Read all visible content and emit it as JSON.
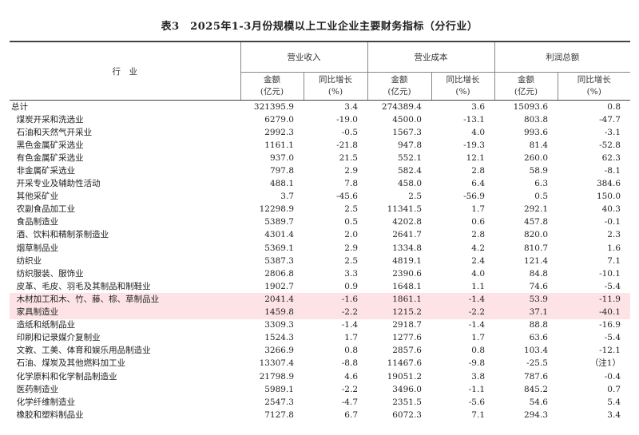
{
  "title": "表3　2025年1-3月份规模以上工业企业主要财务指标（分行业）",
  "header": {
    "industry": "行　业",
    "groups": [
      "营业收入",
      "营业成本",
      "利润总额"
    ],
    "amount": [
      "金额",
      "(亿元)"
    ],
    "growth": [
      "同比增长",
      "(%)"
    ]
  },
  "rows": [
    {
      "name": "总计",
      "v": [
        "321395.9",
        "3.4",
        "274389.4",
        "3.6",
        "15093.6",
        "0.8"
      ]
    },
    {
      "name": "  煤炭开采和洗选业",
      "v": [
        "6279.0",
        "-19.0",
        "4500.0",
        "-13.1",
        "803.8",
        "-47.7"
      ]
    },
    {
      "name": "  石油和天然气开采业",
      "v": [
        "2992.3",
        "-0.5",
        "1567.3",
        "4.0",
        "993.6",
        "-3.1"
      ]
    },
    {
      "name": "  黑色金属矿采选业",
      "v": [
        "1161.1",
        "-21.8",
        "947.8",
        "-19.3",
        "81.4",
        "-52.8"
      ]
    },
    {
      "name": "  有色金属矿采选业",
      "v": [
        "937.0",
        "21.5",
        "552.1",
        "12.1",
        "260.0",
        "62.3"
      ]
    },
    {
      "name": "  非金属矿采选业",
      "v": [
        "797.8",
        "2.9",
        "582.4",
        "2.8",
        "58.9",
        "-8.1"
      ]
    },
    {
      "name": "  开采专业及辅助性活动",
      "v": [
        "488.1",
        "7.8",
        "458.0",
        "6.4",
        "6.3",
        "384.6"
      ]
    },
    {
      "name": "  其他采矿业",
      "v": [
        "3.7",
        "-45.6",
        "2.5",
        "-56.9",
        "0.5",
        "150.0"
      ]
    },
    {
      "name": "  农副食品加工业",
      "v": [
        "12298.9",
        "2.5",
        "11341.5",
        "1.7",
        "292.1",
        "40.3"
      ]
    },
    {
      "name": "  食品制造业",
      "v": [
        "5389.7",
        "0.5",
        "4202.8",
        "0.6",
        "457.8",
        "-0.1"
      ]
    },
    {
      "name": "  酒、饮料和精制茶制造业",
      "v": [
        "4301.4",
        "2.0",
        "2641.7",
        "2.8",
        "820.0",
        "2.3"
      ]
    },
    {
      "name": "  烟草制品业",
      "v": [
        "5369.1",
        "2.9",
        "1334.8",
        "4.2",
        "810.7",
        "1.6"
      ]
    },
    {
      "name": "  纺织业",
      "v": [
        "5387.3",
        "2.5",
        "4819.1",
        "2.4",
        "121.4",
        "7.1"
      ]
    },
    {
      "name": "  纺织服装、服饰业",
      "v": [
        "2806.8",
        "3.3",
        "2390.6",
        "4.0",
        "84.8",
        "-10.1"
      ]
    },
    {
      "name": "  皮革、毛皮、羽毛及其制品和制鞋业",
      "v": [
        "1902.7",
        "0.9",
        "1648.1",
        "1.1",
        "74.6",
        "-5.4"
      ]
    },
    {
      "name": "  木材加工和木、竹、藤、棕、草制品业",
      "v": [
        "2041.4",
        "-1.6",
        "1861.1",
        "-1.4",
        "53.9",
        "-11.9"
      ],
      "highlight": true
    },
    {
      "name": "  家具制造业",
      "v": [
        "1459.8",
        "-2.2",
        "1215.2",
        "-2.2",
        "37.1",
        "-40.1"
      ],
      "highlight": true
    },
    {
      "name": "  造纸和纸制品业",
      "v": [
        "3309.3",
        "-1.4",
        "2918.7",
        "-1.4",
        "88.8",
        "-16.9"
      ]
    },
    {
      "name": "  印刷和记录媒介复制业",
      "v": [
        "1524.3",
        "1.7",
        "1277.6",
        "1.7",
        "63.6",
        "-5.4"
      ]
    },
    {
      "name": "  文教、工美、体育和娱乐用品制造业",
      "v": [
        "3266.9",
        "0.8",
        "2857.6",
        "0.8",
        "103.4",
        "-12.1"
      ]
    },
    {
      "name": "  石油、煤炭及其他燃料加工业",
      "v": [
        "13307.4",
        "-8.8",
        "11467.6",
        "-9.8",
        "-25.5",
        "（注1）"
      ]
    },
    {
      "name": "  化学原料和化学制品制造业",
      "v": [
        "21798.9",
        "4.6",
        "19051.2",
        "3.8",
        "787.6",
        "-0.4"
      ]
    },
    {
      "name": "  医药制造业",
      "v": [
        "5989.1",
        "-2.2",
        "3496.0",
        "-1.1",
        "845.2",
        "0.7"
      ]
    },
    {
      "name": "  化学纤维制造业",
      "v": [
        "2547.3",
        "-4.7",
        "2351.5",
        "-5.6",
        "54.6",
        "5.4"
      ]
    },
    {
      "name": "  橡胶和塑料制品业",
      "v": [
        "7127.8",
        "6.7",
        "6072.3",
        "7.1",
        "294.3",
        "3.4"
      ]
    }
  ]
}
